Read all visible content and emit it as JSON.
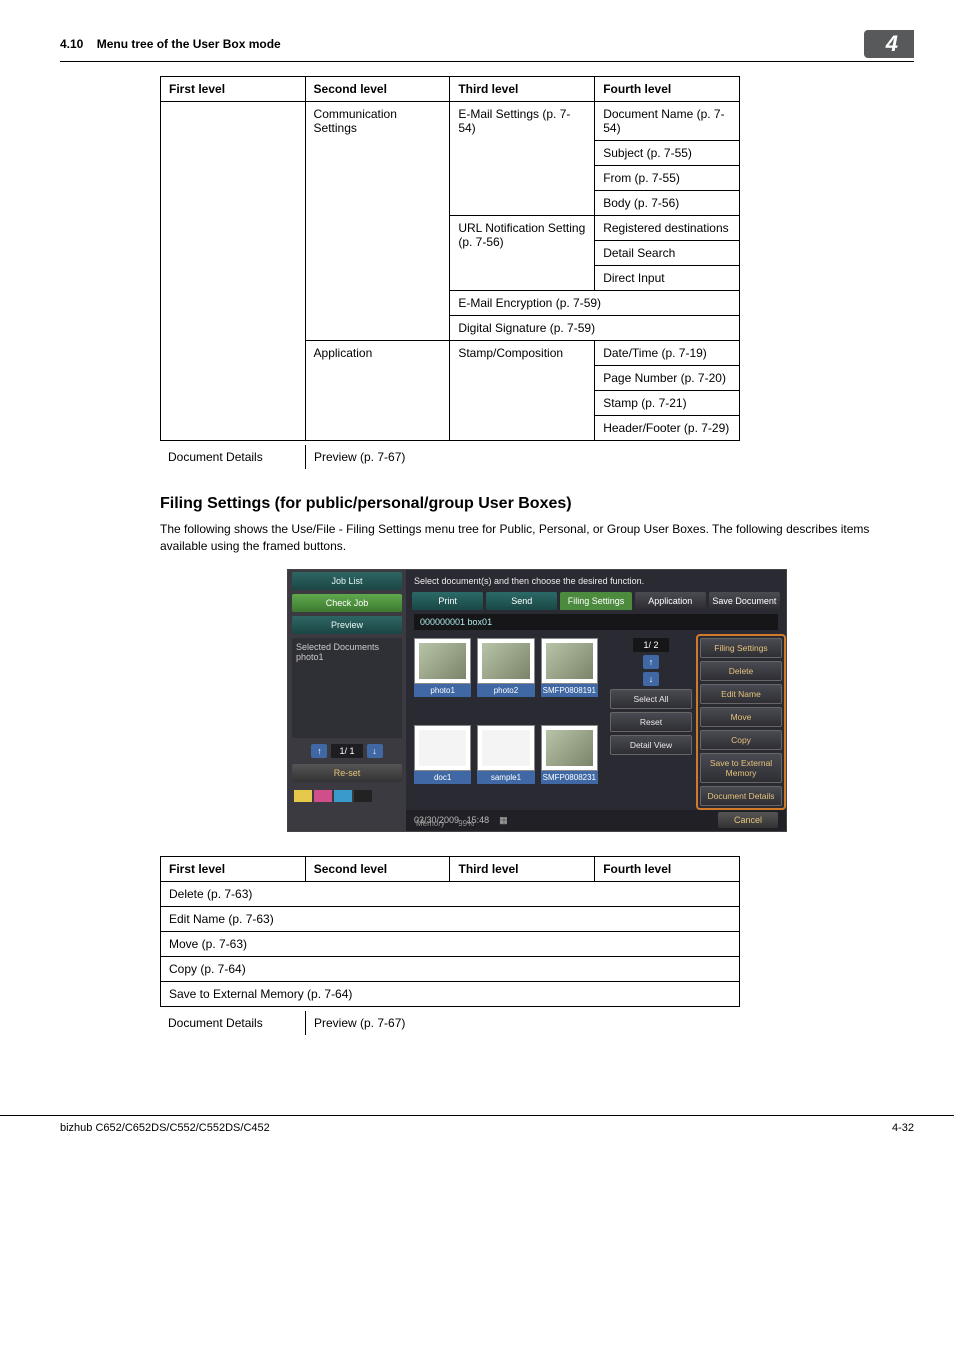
{
  "header": {
    "section_no": "4.10",
    "section_title": "Menu tree of the User Box mode",
    "chapter_no": "4"
  },
  "table1": {
    "headers": [
      "First level",
      "Second level",
      "Third level",
      "Fourth level"
    ],
    "second_level": {
      "comm": "Communication Settings",
      "app": "Application"
    },
    "third_level": {
      "email": "E-Mail Settings (p. 7-54)",
      "url": "URL Notification Setting (p. 7-56)",
      "email_enc": "E-Mail Encryption (p. 7-59)",
      "dig_sig": "Digital Signature (p. 7-59)",
      "stamp": "Stamp/Composition"
    },
    "fourth_level": {
      "docname": "Document Name (p. 7-54)",
      "subject": "Subject (p. 7-55)",
      "from": "From (p. 7-55)",
      "body": "Body (p. 7-56)",
      "reg": "Registered destinations",
      "detail": "Detail Search",
      "direct": "Direct Input",
      "datetime": "Date/Time (p. 7-19)",
      "pagenum": "Page Number (p. 7-20)",
      "stamp": "Stamp (p. 7-21)",
      "hf": "Header/Footer (p. 7-29)"
    },
    "below": {
      "doc_details": "Document Details",
      "preview": "Preview (p. 7-67)"
    }
  },
  "section2": {
    "title": "Filing Settings (for public/personal/group User Boxes)",
    "body": "The following shows the Use/File - Filing Settings menu tree for Public, Personal, or Group User Boxes. The following describes items available using the framed buttons."
  },
  "screenshot": {
    "topbar": "Select document(s) and then choose the desired function.",
    "left": {
      "job_list": "Job List",
      "check_job": "Check Job",
      "preview": "Preview",
      "sel_docs_title": "Selected Documents",
      "sel_docs_item": "photo1",
      "page": "1/  1",
      "reset": "Re-set"
    },
    "tabs": {
      "print": "Print",
      "send": "Send",
      "filing": "Filing Settings",
      "application": "Application",
      "save": "Save Document"
    },
    "crumb": "000000001   box01",
    "thumbs": [
      "photo1",
      "photo2",
      "SMFP0808191",
      "doc1",
      "sample1",
      "SMFP0808231"
    ],
    "right": {
      "page": "1/  2",
      "filing_settings": "Filing Settings",
      "delete": "Delete",
      "edit_name": "Edit Name",
      "move": "Move",
      "copy": "Copy",
      "save_ext": "Save to External Memory",
      "doc_details": "Document Details",
      "select_all": "Select All",
      "reset": "Reset",
      "detail_view": "Detail View"
    },
    "status": {
      "date": "03/30/2009",
      "time": "15:48",
      "mem": "Memory",
      "mem_pct": "99%",
      "cancel": "Cancel"
    }
  },
  "table2": {
    "headers": [
      "First level",
      "Second level",
      "Third level",
      "Fourth level"
    ],
    "rows": {
      "delete": "Delete (p. 7-63)",
      "edit": "Edit Name (p. 7-63)",
      "move": "Move (p. 7-63)",
      "copy": "Copy (p. 7-64)",
      "save": "Save to External Memory (p. 7-64)"
    },
    "below": {
      "doc_details": "Document Details",
      "preview": "Preview (p. 7-67)"
    }
  },
  "footer": {
    "model": "bizhub C652/C652DS/C552/C552DS/C452",
    "page": "4-32"
  }
}
